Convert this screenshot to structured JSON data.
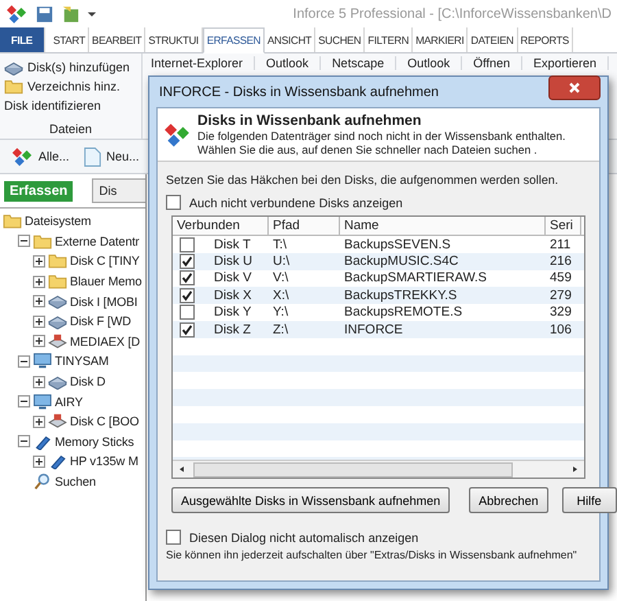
{
  "window": {
    "title": "Inforce 5 Professional - [C:\\InforceWissensbanken\\D"
  },
  "ribbon_tabs": [
    {
      "label": "FILE",
      "kind": "file",
      "selected": false
    },
    {
      "label": "START",
      "kind": "tab",
      "selected": false
    },
    {
      "label": "BEARBEIT",
      "kind": "tab",
      "selected": false
    },
    {
      "label": "STRUKTUI",
      "kind": "tab",
      "selected": false
    },
    {
      "label": "ERFASSEN",
      "kind": "tab",
      "selected": true
    },
    {
      "label": "ANSICHT",
      "kind": "tab",
      "selected": false
    },
    {
      "label": "SUCHEN",
      "kind": "tab",
      "selected": false
    },
    {
      "label": "FILTERN",
      "kind": "tab",
      "selected": false
    },
    {
      "label": "MARKIERI",
      "kind": "tab",
      "selected": false
    },
    {
      "label": "DATEIEN",
      "kind": "tab",
      "selected": false
    },
    {
      "label": "REPORTS",
      "kind": "tab",
      "selected": false
    }
  ],
  "ribbon": {
    "group": {
      "label": "Dateien",
      "items": [
        {
          "label": "Disk(s) hinzufügen",
          "kind": "disk"
        },
        {
          "label": "Verzeichnis hinz.",
          "kind": "folder"
        },
        {
          "label": "Disk identifizieren",
          "kind": "plain"
        }
      ]
    },
    "commands": [
      "Internet-Explorer",
      "Outlook",
      "Netscape",
      "Outlook",
      "Öffnen",
      "Exportieren"
    ]
  },
  "toolbar": {
    "items": [
      {
        "label": "Alle...",
        "kind": "tiles"
      },
      {
        "label": "Neu...",
        "kind": "page"
      }
    ]
  },
  "left_panel": {
    "capture_button": "Erfassen",
    "second_button": "Dis",
    "tree": [
      {
        "label": "Dateisystem",
        "kind": "folder",
        "children": [
          {
            "label": "Externe Datentr",
            "kind": "folder",
            "expanded": true,
            "children": [
              {
                "label": "Disk C [TINY",
                "kind": "folder",
                "expanded": false
              },
              {
                "label": "Blauer Memo",
                "kind": "folder",
                "expanded": false
              },
              {
                "label": "Disk I [MOBI",
                "kind": "disk",
                "expanded": false
              },
              {
                "label": "Disk F [WD",
                "kind": "disk",
                "expanded": false
              },
              {
                "label": "MEDIAEX [D",
                "kind": "media",
                "expanded": false
              }
            ]
          },
          {
            "label": "TINYSAM",
            "kind": "computer",
            "expanded": true,
            "children": [
              {
                "label": "Disk D",
                "kind": "disk",
                "expanded": false
              }
            ]
          },
          {
            "label": "AIRY",
            "kind": "computer",
            "expanded": true,
            "children": [
              {
                "label": "Disk C [BOO",
                "kind": "media",
                "expanded": false
              }
            ]
          },
          {
            "label": "Memory Sticks",
            "kind": "stick",
            "expanded": true,
            "children": [
              {
                "label": "HP v135w M",
                "kind": "stick",
                "expanded": false
              }
            ]
          },
          {
            "label": "Suchen",
            "kind": "search"
          }
        ]
      }
    ]
  },
  "dialog": {
    "title": "INFORCE - Disks in Wissensbank aufnehmen",
    "heading": "Disks in Wissenbank aufnehmen",
    "description_lines": [
      "Die folgenden Datenträger sind noch nicht in der Wissensbank enthalten.",
      "Wählen Sie die aus, auf denen Sie schneller nach Dateien suchen ."
    ],
    "instruction": "Setzen Sie das Häkchen bei den Disks, die aufgenommen werden sollen.",
    "show_disconnected": {
      "label": "Auch nicht verbundene Disks anzeigen",
      "checked": false
    },
    "table": {
      "columns": [
        "Verbunden",
        "Pfad",
        "Name",
        "Seri"
      ],
      "rows": [
        {
          "checked": false,
          "disk": "Disk T",
          "path": "T:\\",
          "name": "BackupsSEVEN.S",
          "serial": "211"
        },
        {
          "checked": true,
          "disk": "Disk U",
          "path": "U:\\",
          "name": "BackupMUSIC.S4C",
          "serial": "216"
        },
        {
          "checked": true,
          "disk": "Disk V",
          "path": "V:\\",
          "name": "BackupSMARTIERAW.S",
          "serial": "459"
        },
        {
          "checked": true,
          "disk": "Disk X",
          "path": "X:\\",
          "name": "BackupsTREKKY.S",
          "serial": "279"
        },
        {
          "checked": false,
          "disk": "Disk Y",
          "path": "Y:\\",
          "name": "BackupsREMOTE.S",
          "serial": "329"
        },
        {
          "checked": true,
          "disk": "Disk Z",
          "path": "Z:\\",
          "name": "INFORCE",
          "serial": "106"
        }
      ]
    },
    "buttons": [
      "Ausgewählte Disks in Wissensbank aufnehmen",
      "Abbrechen",
      "Hilfe"
    ],
    "dont_show": {
      "label": "Diesen Dialog nicht automalisch anzeigen",
      "checked": false
    },
    "note": "Sie können ihn jederzeit aufschalten über \"Extras/Disks in Wissensbank aufnehmen\""
  }
}
